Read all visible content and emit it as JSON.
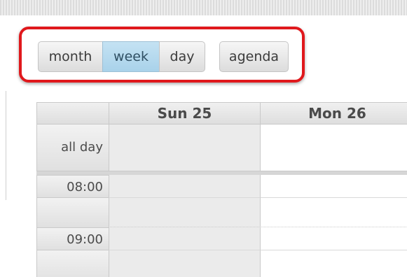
{
  "view_buttons": {
    "month": "month",
    "week": "week",
    "day": "day",
    "agenda": "agenda",
    "active": "week"
  },
  "calendar": {
    "columns": [
      "Sun 25",
      "Mon 26"
    ],
    "all_day_label": "all day",
    "time_slots": [
      "08:00",
      "09:00"
    ]
  },
  "colors": {
    "highlight_ring": "#e0181c",
    "active_button": "#b4d9ee"
  }
}
